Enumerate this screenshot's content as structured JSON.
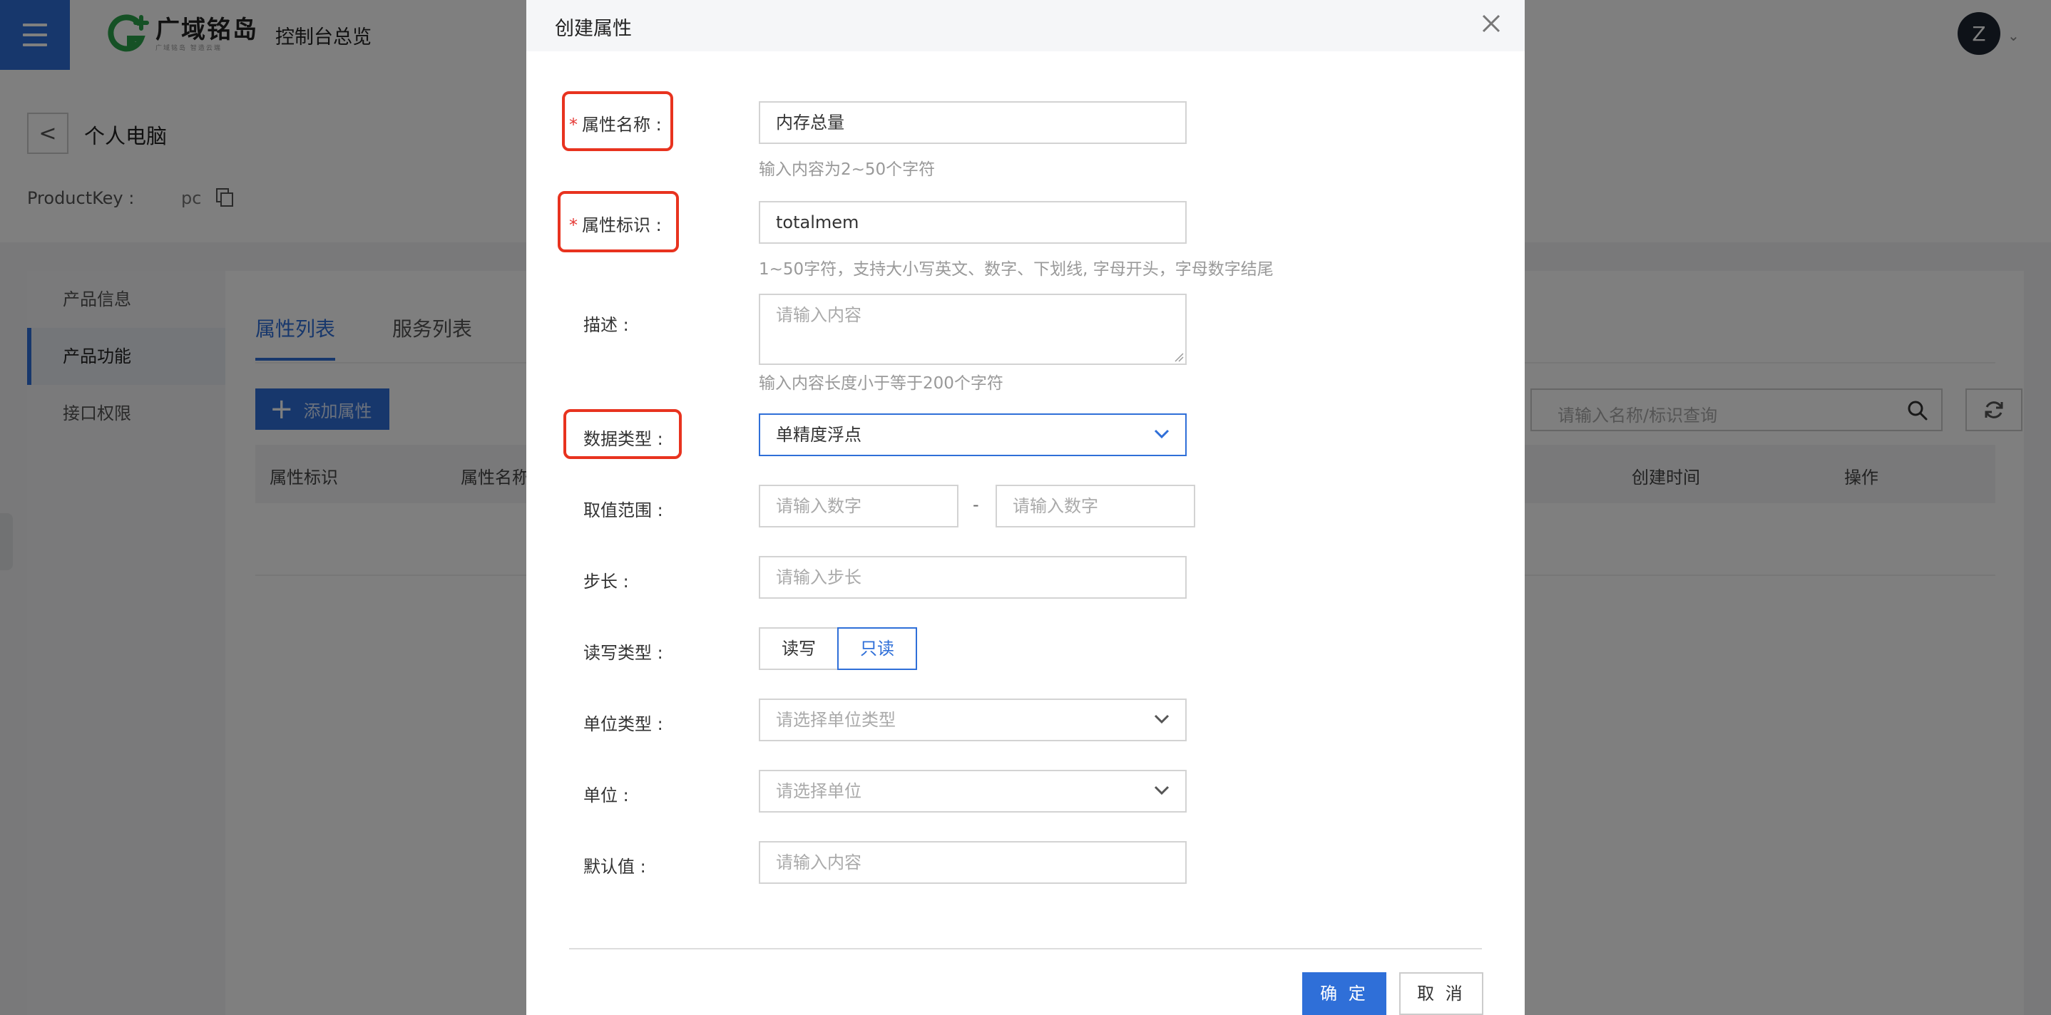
{
  "header": {
    "logo_name": "广域铭岛",
    "logo_sub": "广域铭岛 智造云端",
    "title": "控制台总览",
    "avatar_initial": "Z"
  },
  "product": {
    "name": "个人电脑",
    "key_label": "ProductKey :",
    "key_value": "pc"
  },
  "sidebar": {
    "items": [
      {
        "label": "产品信息"
      },
      {
        "label": "产品功能"
      },
      {
        "label": "接口权限"
      }
    ]
  },
  "tabs": [
    {
      "label": "属性列表"
    },
    {
      "label": "服务列表"
    }
  ],
  "toolbar": {
    "add_label": "添加属性",
    "search_placeholder": "请输入名称/标识查询"
  },
  "table": {
    "columns": [
      "属性标识",
      "属性名称",
      "创建时间",
      "操作"
    ]
  },
  "modal": {
    "title": "创建属性",
    "fields": {
      "name": {
        "label": "属性名称 :",
        "value": "内存总量",
        "hint": "输入内容为2~50个字符"
      },
      "identifier": {
        "label": "属性标识 :",
        "value": "totalmem",
        "hint": "1~50字符，支持大小写英文、数字、下划线, 字母开头，字母数字结尾"
      },
      "description": {
        "label": "描述 :",
        "placeholder": "请输入内容",
        "hint": "输入内容长度小于等于200个字符"
      },
      "data_type": {
        "label": "数据类型 :",
        "value": "单精度浮点"
      },
      "range": {
        "label": "取值范围 :",
        "min_placeholder": "请输入数字",
        "separator": "-",
        "max_placeholder": "请输入数字"
      },
      "step": {
        "label": "步长 :",
        "placeholder": "请输入步长"
      },
      "rw": {
        "label": "读写类型 :",
        "options": [
          "读写",
          "只读"
        ],
        "selected": "只读"
      },
      "unit_type": {
        "label": "单位类型 :",
        "placeholder": "请选择单位类型"
      },
      "unit": {
        "label": "单位 :",
        "placeholder": "请选择单位"
      },
      "default": {
        "label": "默认值 :",
        "placeholder": "请输入内容"
      }
    },
    "ok_label": "确 定",
    "cancel_label": "取 消"
  },
  "colors": {
    "accent": "#2f6fd8",
    "highlight": "#e8331f",
    "required": "#e53935"
  }
}
